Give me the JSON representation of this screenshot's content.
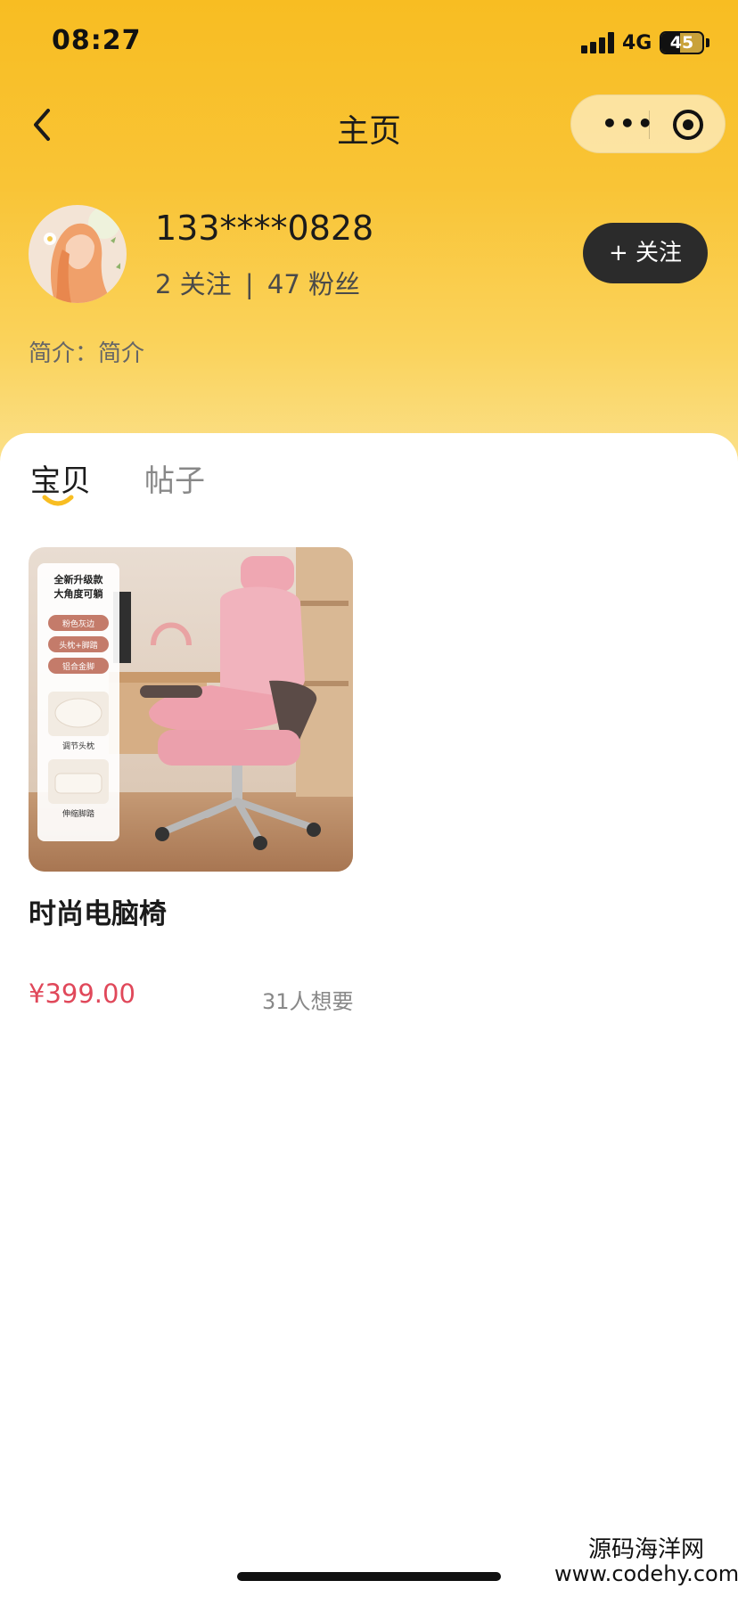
{
  "status_bar": {
    "time": "08:27",
    "network": "4G",
    "battery": "45"
  },
  "nav": {
    "title": "主页",
    "more_icon": "more-dots-icon",
    "target_icon": "target-icon"
  },
  "profile": {
    "username": "133****0828",
    "following_count": "2",
    "following_label": "关注",
    "separator": "|",
    "fans_count": "47",
    "fans_label": "粉丝",
    "follow_button": "+ 关注",
    "bio": "简介：简介"
  },
  "tabs": [
    {
      "label": "宝贝",
      "active": true
    },
    {
      "label": "帖子",
      "active": false
    }
  ],
  "products": [
    {
      "title": "时尚电脑椅",
      "price": "¥399.00",
      "wants": "31人想要",
      "image_badges": [
        "全新升级款",
        "大角度可躺",
        "粉色灰边",
        "头枕+脚踏",
        "铝合金脚",
        "调节头枕",
        "伸缩脚踏"
      ]
    }
  ],
  "watermark": {
    "name": "源码海洋网",
    "url": "www.codehy.com"
  },
  "colors": {
    "header_yellow": "#f8bd22",
    "price_red": "#e0485a",
    "follow_button_bg": "#2b2b2b"
  }
}
